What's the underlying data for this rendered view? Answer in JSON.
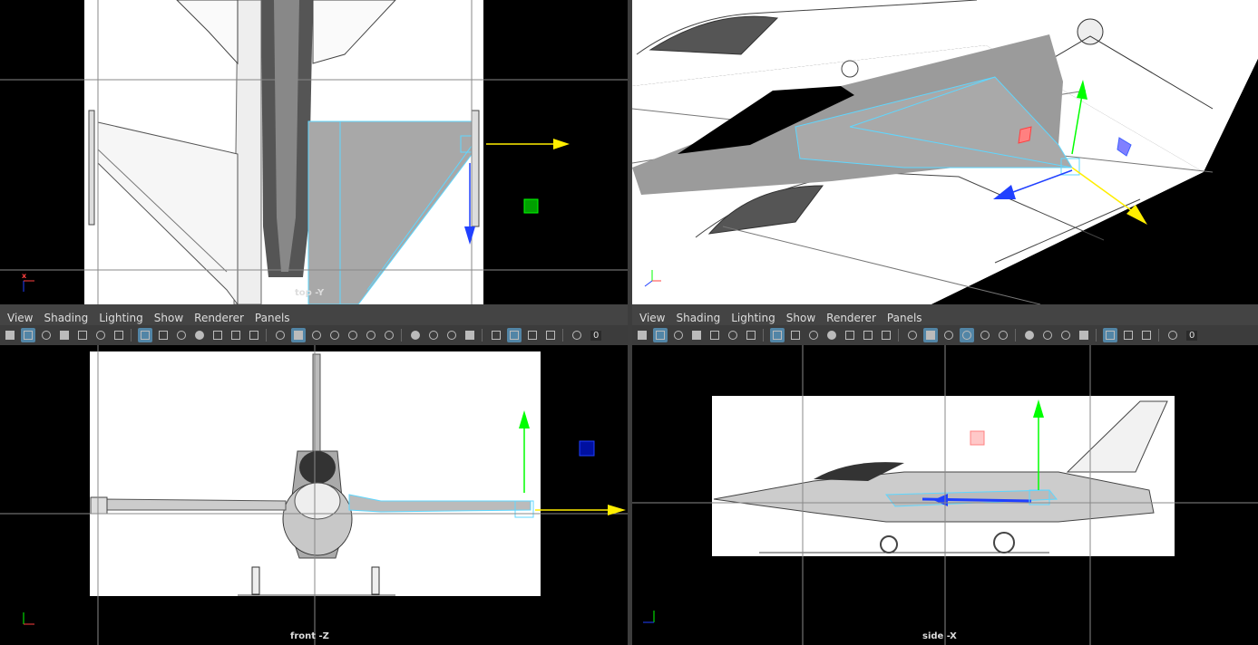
{
  "menus": {
    "left": [
      "View",
      "Shading",
      "Lighting",
      "Show",
      "Renderer",
      "Panels"
    ],
    "right": [
      "View",
      "Shading",
      "Lighting",
      "Show",
      "Renderer",
      "Panels"
    ]
  },
  "viewports": {
    "top_left": {
      "label": "top -Y"
    },
    "top_right": {
      "label": ""
    },
    "bottom_left": {
      "label": "front -Z"
    },
    "bottom_right": {
      "label": "side -X"
    }
  },
  "toolbar": {
    "left_value": "0",
    "right_value": "0"
  },
  "axis_labels": {
    "x": "x",
    "y": "y",
    "z": "z"
  },
  "colors": {
    "selection": "#5fd7ff",
    "x_axis": "#ff4040",
    "y_axis": "#00ff00",
    "z_axis": "#2040ff",
    "handle_yellow": "#ffee00"
  },
  "icons": [
    "camera-icon",
    "select-camera-icon",
    "lock-icon",
    "bookmark-icon",
    "image-plane-icon",
    "grid-icon",
    "film-gate-icon",
    "resolution-gate-icon",
    "gate-mask-icon",
    "field-chart-icon",
    "safe-action-icon",
    "safe-title-icon",
    "wireframe-icon",
    "smooth-shade-icon",
    "wireframe-on-shaded-icon",
    "xray-icon",
    "textured-icon",
    "lights-icon",
    "shadows-icon",
    "ambient-occlusion-icon",
    "motion-blur-icon",
    "anti-alias-icon",
    "depth-of-field-icon",
    "isolate-select-icon",
    "xray-joints-icon",
    "xray-active-icon",
    "exposure-icon"
  ]
}
